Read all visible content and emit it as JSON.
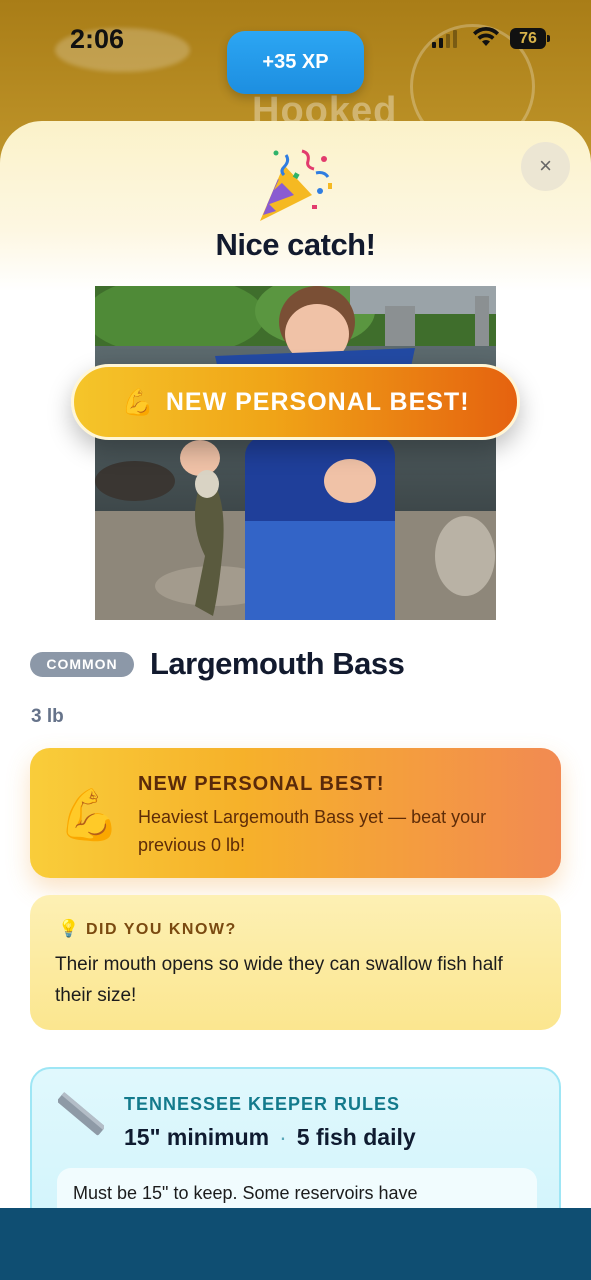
{
  "status_bar": {
    "time": "2:06",
    "battery": "76"
  },
  "xp_badge": "+35 XP",
  "background_app": {
    "title": "Hooked"
  },
  "sheet": {
    "close_label": "×",
    "title": "Nice catch!",
    "photo_banner": {
      "icon": "💪",
      "text": "NEW PERSONAL BEST!"
    }
  },
  "fish": {
    "rarity": "COMMON",
    "name": "Largemouth Bass",
    "weight": "3 lb"
  },
  "personal_best_card": {
    "icon": "💪",
    "title": "NEW PERSONAL BEST!",
    "description": "Heaviest Largemouth Bass yet — beat your previous 0 lb!"
  },
  "did_you_know": {
    "icon": "💡",
    "title": "DID YOU KNOW?",
    "text": "Their mouth opens so wide they can swallow fish half their size!"
  },
  "keeper_rules": {
    "title": "TENNESSEE KEEPER RULES",
    "minimum": "15\" minimum",
    "separator": "·",
    "daily": "5 fish daily",
    "note": "Must be 15\" to keep. Some reservoirs have"
  },
  "colors": {
    "accent_blue": "#1d8ee0",
    "gold": "#f6b12a",
    "orange": "#e5620f",
    "teal": "#137a8c",
    "navy_bar": "#0f4e72"
  }
}
